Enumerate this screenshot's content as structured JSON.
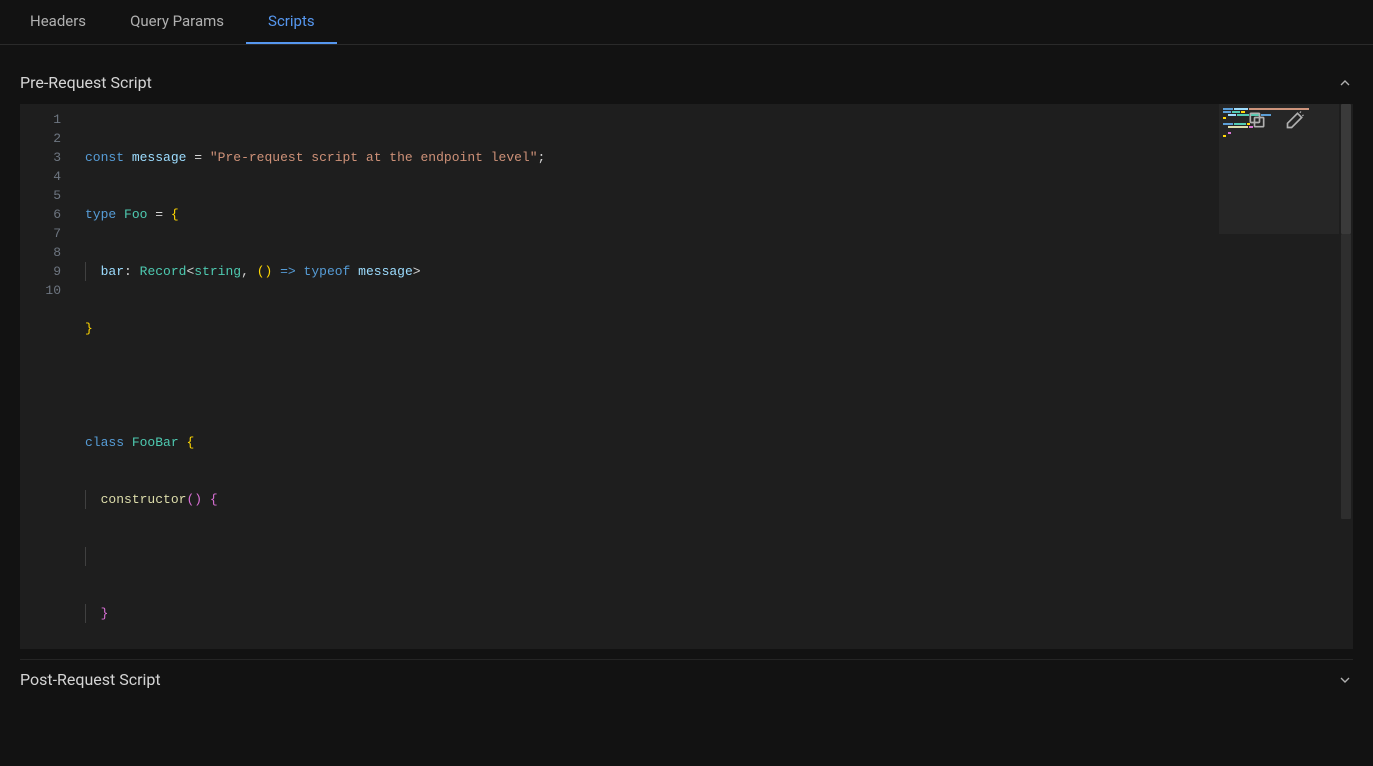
{
  "tabs": [
    {
      "label": "Headers",
      "active": false
    },
    {
      "label": "Query Params",
      "active": false
    },
    {
      "label": "Scripts",
      "active": true
    }
  ],
  "preRequest": {
    "title": "Pre-Request Script",
    "expanded": true,
    "lineNumbers": [
      "1",
      "2",
      "3",
      "4",
      "5",
      "6",
      "7",
      "8",
      "9",
      "10"
    ],
    "currentLine": 10,
    "code": {
      "l1": {
        "kw": "const",
        "var": "message",
        "op": "=",
        "str": "\"Pre-request script at the endpoint level\"",
        "semi": ";"
      },
      "l2": {
        "kw": "type",
        "type": "Foo",
        "op": "=",
        "brc": "{"
      },
      "l3": {
        "var": "bar",
        "colon": ":",
        "type1": "Record",
        "lt": "<",
        "type2": "string",
        "comma": ",",
        "paren": "()",
        "arrow": "=>",
        "kw": "typeof",
        "var2": "message",
        "gt": ">"
      },
      "l4": {
        "brc": "}"
      },
      "l5": {
        "blank": ""
      },
      "l6": {
        "kw": "class",
        "type": "FooBar",
        "brc": "{"
      },
      "l7": {
        "fn": "constructor",
        "paren": "()",
        "brc": "{"
      },
      "l8": {
        "blank": ""
      },
      "l9": {
        "brc": "}"
      },
      "l10": {
        "brc": "}"
      }
    }
  },
  "postRequest": {
    "title": "Post-Request Script",
    "expanded": false
  }
}
